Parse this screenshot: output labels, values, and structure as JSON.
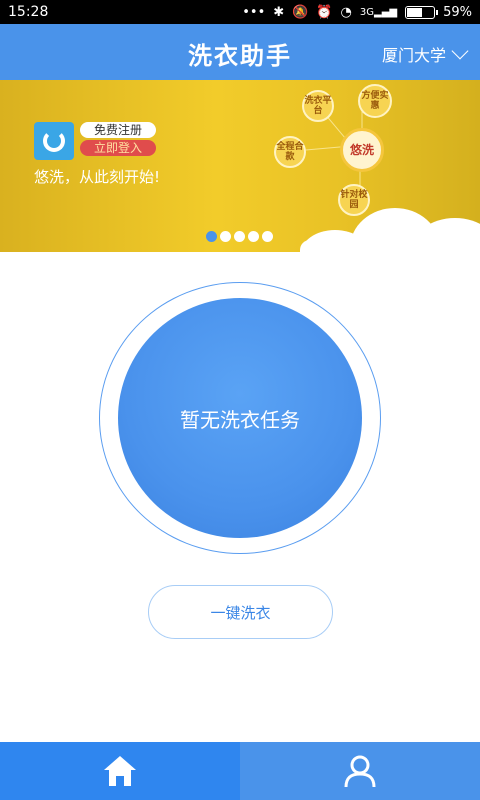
{
  "status_bar": {
    "time": "15:28",
    "signal_label": "3G",
    "battery_percent": "59%",
    "battery_level": 0.59
  },
  "header": {
    "title": "洗衣助手",
    "location": "厦门大学"
  },
  "banner": {
    "register_label": "免费注册",
    "login_label": "立即登入",
    "slogan": "悠洗，从此刻开始!",
    "bubbles": {
      "center": "悠洗",
      "top_left": "洗衣平台",
      "top_right": "方便实惠",
      "left": "全程合款",
      "bottom": "针对校园"
    },
    "pager": {
      "count": 5,
      "active_index": 0
    }
  },
  "main": {
    "status_text": "暂无洗衣任务",
    "wash_button_label": "一键洗衣"
  },
  "tabbar": {
    "home_icon": "home-icon",
    "user_icon": "user-icon"
  },
  "colors": {
    "primary": "#4a93ea",
    "tab_active": "#2f86ef",
    "banner_yellow": "#f2cc2a"
  }
}
